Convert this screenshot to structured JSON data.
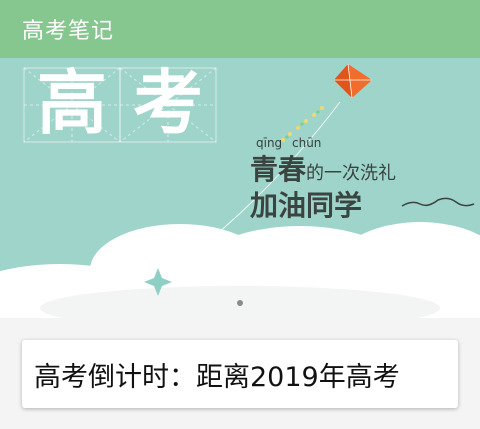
{
  "app_bar": {
    "title": "高考笔记"
  },
  "banner": {
    "headline_chars": [
      "高",
      "考"
    ],
    "pinyin": [
      "qīng",
      "chūn"
    ],
    "slogan_line1_emph": "青春",
    "slogan_line1_rest": "的一次洗礼",
    "slogan_line2": "加油同学",
    "colors": {
      "background": "#9fd4cb",
      "kite": "#f26d2c",
      "text": "#3a4441"
    }
  },
  "carousel": {
    "active_index": 0,
    "page_count": 1
  },
  "countdown": {
    "text": "高考倒计时：距离2019年高考"
  },
  "theme": {
    "accent": "#86c68f"
  }
}
